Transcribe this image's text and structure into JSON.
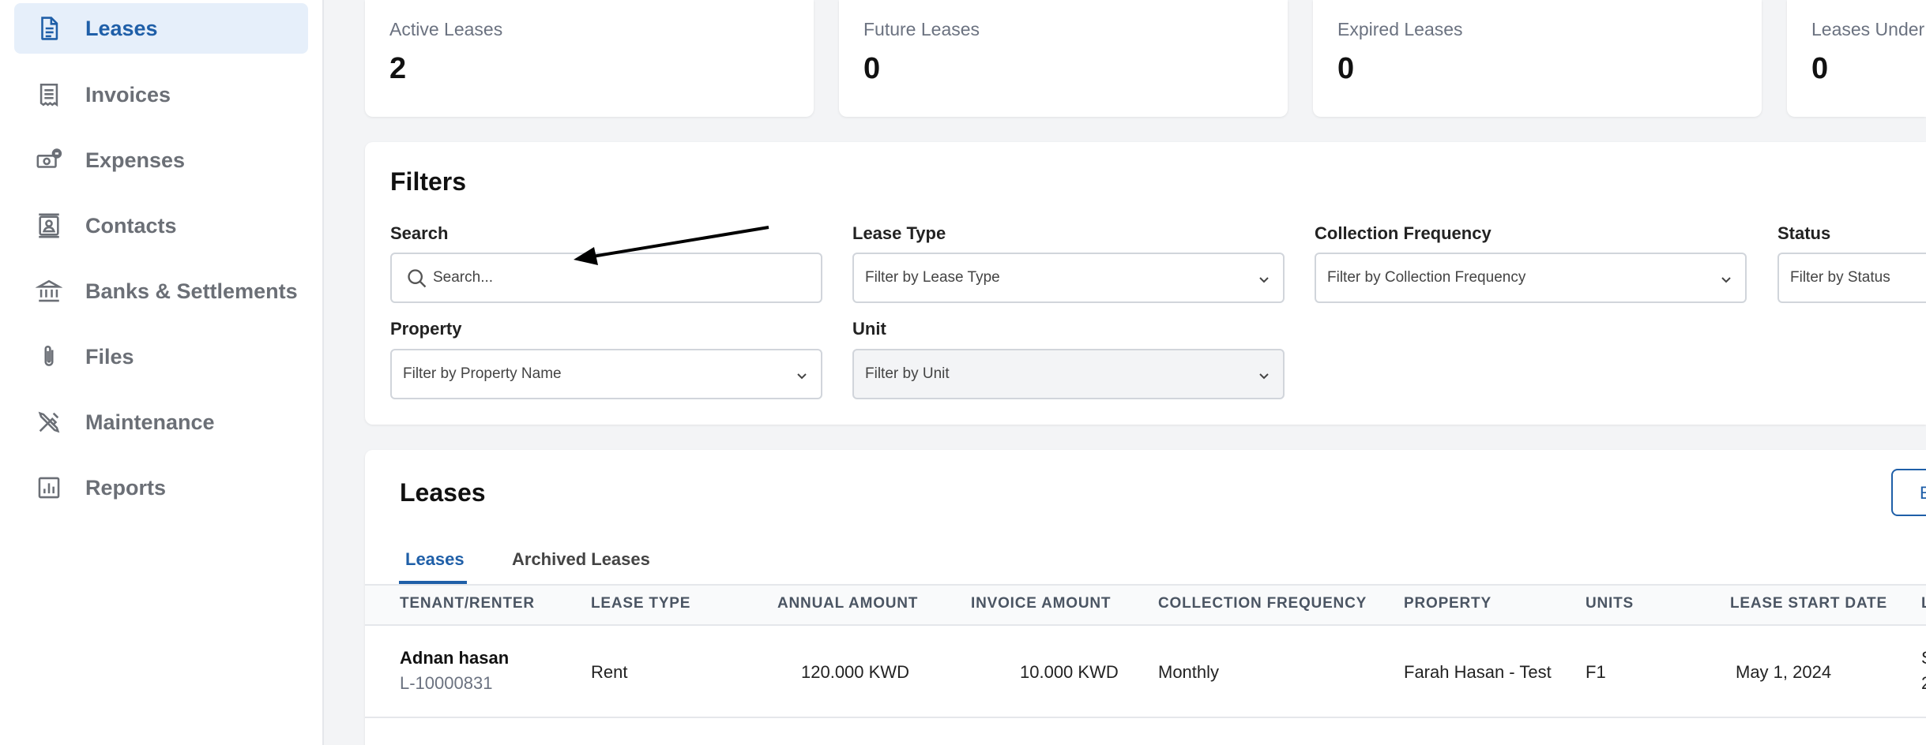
{
  "sidebar": {
    "items": [
      {
        "label": "Leases",
        "icon": "document-icon",
        "active": true
      },
      {
        "label": "Invoices",
        "icon": "receipt-icon"
      },
      {
        "label": "Expenses",
        "icon": "cash-icon"
      },
      {
        "label": "Contacts",
        "icon": "contact-card-icon"
      },
      {
        "label": "Banks & Settlements",
        "icon": "bank-icon"
      },
      {
        "label": "Files",
        "icon": "paperclip-icon"
      },
      {
        "label": "Maintenance",
        "icon": "tools-icon"
      },
      {
        "label": "Reports",
        "icon": "bar-chart-icon"
      }
    ]
  },
  "stats": [
    {
      "label": "Active Leases",
      "value": "2"
    },
    {
      "label": "Future Leases",
      "value": "0"
    },
    {
      "label": "Expired Leases",
      "value": "0"
    },
    {
      "label": "Leases Under R",
      "value": "0"
    }
  ],
  "filters": {
    "title": "Filters",
    "search": {
      "label": "Search",
      "placeholder": "Search..."
    },
    "lease_type": {
      "label": "Lease Type",
      "placeholder": "Filter by Lease Type"
    },
    "collection_frequency": {
      "label": "Collection Frequency",
      "placeholder": "Filter by Collection Frequency"
    },
    "status": {
      "label": "Status",
      "placeholder": "Filter by Status"
    },
    "property": {
      "label": "Property",
      "placeholder": "Filter by Property Name"
    },
    "unit": {
      "label": "Unit",
      "placeholder": "Filter by Unit"
    }
  },
  "leases": {
    "title": "Leases",
    "export_label": "E",
    "tabs": [
      {
        "label": "Leases",
        "active": true
      },
      {
        "label": "Archived Leases"
      }
    ],
    "columns": [
      "TENANT/RENTER",
      "LEASE TYPE",
      "ANNUAL AMOUNT",
      "INVOICE AMOUNT",
      "COLLECTION FREQUENCY",
      "PROPERTY",
      "UNITS",
      "LEASE START DATE",
      "L"
    ],
    "rows": [
      {
        "tenant": "Adnan hasan",
        "lease_id": "L-10000831",
        "lease_type": "Rent",
        "annual_amount": "120.000 KWD",
        "invoice_amount": "10.000 KWD",
        "collection_frequency": "Monthly",
        "property": "Farah Hasan - Test",
        "units": "F1",
        "start_date": "May 1, 2024",
        "end_date_partial": "S",
        "end_date_partial2": "2"
      }
    ]
  },
  "colors": {
    "accent": "#1f5fa8",
    "active_bg": "#e6effa",
    "arrow": "#000000"
  }
}
